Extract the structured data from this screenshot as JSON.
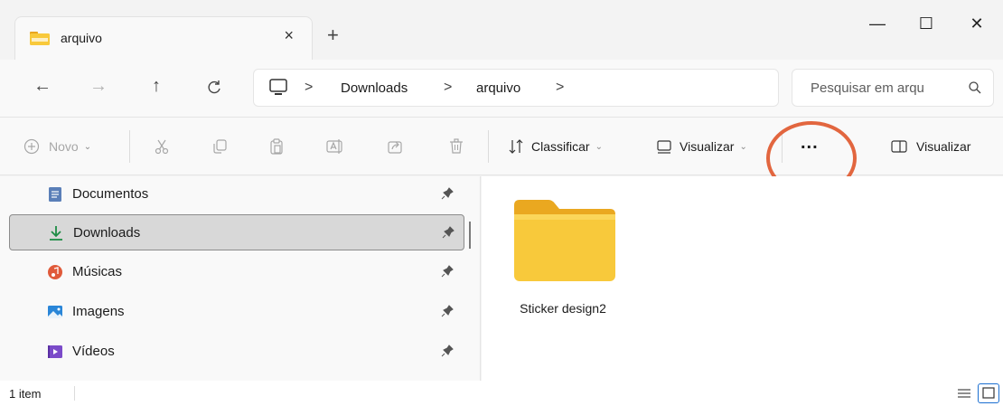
{
  "titlebar": {
    "tab_title": "arquivo",
    "tab_close": "×",
    "new_tab": "+",
    "minimize": "—",
    "maximize": "☐",
    "close": "✕"
  },
  "nav": {
    "back": "←",
    "forward": "→",
    "up": "↑",
    "refresh": "C"
  },
  "address": {
    "crumbs": [
      "Downloads",
      "arquivo"
    ],
    "separator": ">"
  },
  "search": {
    "placeholder": "Pesquisar em arqu"
  },
  "toolbar": {
    "new_label": "Novo",
    "sort_label": "Classificar",
    "view_label": "Visualizar",
    "more_label": "...",
    "preview_label": "Visualizar"
  },
  "sidebar": {
    "items": [
      {
        "label": "Documentos",
        "icon": "document-icon"
      },
      {
        "label": "Downloads",
        "icon": "download-icon"
      },
      {
        "label": "Músicas",
        "icon": "music-icon"
      },
      {
        "label": "Imagens",
        "icon": "image-icon"
      },
      {
        "label": "Vídeos",
        "icon": "video-icon"
      }
    ]
  },
  "content": {
    "items": [
      {
        "name": "Sticker design2",
        "type": "folder"
      }
    ]
  },
  "status": {
    "count": "1 item"
  },
  "colors": {
    "accent": "#1b6fd1",
    "folder": "#f8c93b",
    "highlight": "#e2663f"
  }
}
